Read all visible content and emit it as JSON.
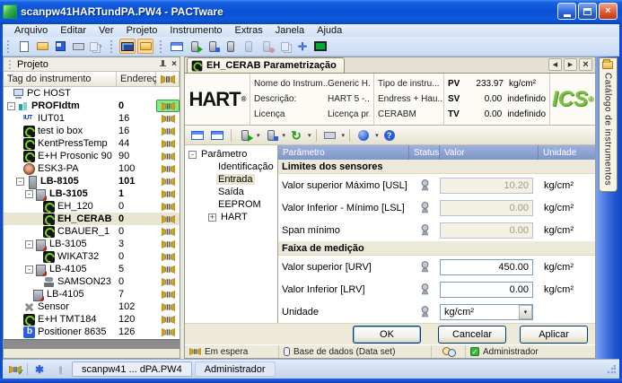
{
  "glyphs": {
    "dropdown": "▾",
    "nav_prev": "◀",
    "nav_next": "▶",
    "close": "×",
    "refresh": "↻",
    "help": "?",
    "asterisk": "✱",
    "pause": "||",
    "check": "✓",
    "reg": "®",
    "move": "✛"
  },
  "window": {
    "title": "scanpw41HARTundPA.PW4 - PACTware"
  },
  "menu": [
    "Arquivo",
    "Editar",
    "Ver",
    "Projeto",
    "Instrumento",
    "Extras",
    "Janela",
    "Ajuda"
  ],
  "project_panel": {
    "title": "Projeto",
    "columns": {
      "tag": "Tag do instrumento",
      "address": "Endereço"
    },
    "rows": [
      {
        "tag": "PC HOST",
        "addr": "",
        "icon": "pc",
        "level": 0,
        "noplug": true
      },
      {
        "tag": "PROFIdtm",
        "addr": "0",
        "icon": "profi",
        "level": 1,
        "bold": true,
        "expand": "-",
        "plugsel": true
      },
      {
        "tag": "IUT01",
        "addr": "16",
        "icon": "iut",
        "level": 2
      },
      {
        "tag": "test io box",
        "addr": "16",
        "icon": "ics",
        "level": 2
      },
      {
        "tag": "KentPressTemp",
        "addr": "44",
        "icon": "ics",
        "level": 2
      },
      {
        "tag": "E+H Prosonic 90",
        "addr": "90",
        "icon": "ics",
        "level": 2
      },
      {
        "tag": "ESK3-PA",
        "addr": "100",
        "icon": "esk",
        "level": 2
      },
      {
        "tag": "LB-8105",
        "addr": "101",
        "icon": "lb8",
        "level": 2,
        "bold": true,
        "expand": "-"
      },
      {
        "tag": "LB-3105",
        "addr": "1",
        "icon": "lb3",
        "level": 3,
        "bold": true,
        "expand": "-"
      },
      {
        "tag": "EH_120",
        "addr": "0",
        "icon": "ics",
        "level": 4
      },
      {
        "tag": "EH_CERAB",
        "addr": "0",
        "icon": "ics",
        "level": 4,
        "bold": true,
        "selected": true
      },
      {
        "tag": "CBAUER_1",
        "addr": "0",
        "icon": "ics",
        "level": 4
      },
      {
        "tag": "LB-3105",
        "addr": "3",
        "icon": "lb3",
        "level": 3,
        "expand": "-"
      },
      {
        "tag": "WIKAT32",
        "addr": "0",
        "icon": "ics",
        "level": 4
      },
      {
        "tag": "LB-4105",
        "addr": "5",
        "icon": "lb3",
        "level": 3,
        "expand": "-"
      },
      {
        "tag": "SAMSON23",
        "addr": "0",
        "icon": "samson",
        "level": 4
      },
      {
        "tag": "LB-4105",
        "addr": "7",
        "icon": "lb3",
        "level": 3
      },
      {
        "tag": "Sensor",
        "addr": "102",
        "icon": "sensor",
        "level": 2
      },
      {
        "tag": "E+H TMT184",
        "addr": "120",
        "icon": "ics",
        "level": 2
      },
      {
        "tag": "Positioner 8635",
        "addr": "126",
        "icon": "pos",
        "level": 2
      }
    ]
  },
  "doc": {
    "tab": "EH_CERAB Parametrização",
    "header": {
      "hart_logo": "HART",
      "ics_logo": "ICS",
      "fields": [
        {
          "label": "Nome do Instrum...",
          "value": "Generic H..."
        },
        {
          "label": "Descrição:",
          "value": "HART 5 -..."
        },
        {
          "label": "Licença",
          "value": "Licença pr..."
        }
      ],
      "col2": [
        "Tipo de instru...",
        "Endress + Hau...",
        "CERABM"
      ],
      "pv": [
        {
          "name": "PV",
          "value": "233.97",
          "unit": "kg/cm²"
        },
        {
          "name": "SV",
          "value": "0.00",
          "unit": "indefinido"
        },
        {
          "name": "TV",
          "value": "0.00",
          "unit": "indefinido"
        }
      ]
    },
    "tree": {
      "root": "Parâmetro",
      "root_expand": "-",
      "items": [
        {
          "label": "Identificação"
        },
        {
          "label": "Entrada",
          "selected": true
        },
        {
          "label": "Saída"
        },
        {
          "label": "EEPROM"
        },
        {
          "label": "HART",
          "expand": "+"
        }
      ]
    },
    "table": {
      "headers": {
        "param": "Parâmetro",
        "status": "Status",
        "value": "Valor",
        "unit": "Unidade"
      },
      "sections": [
        {
          "title": "Limites dos sensores",
          "rows": [
            {
              "label": "Valor superior Máximo [USL]",
              "value": "10.20",
              "unit": "kg/cm²",
              "disabled": true
            },
            {
              "label": "Valor Inferior - Mínimo [LSL]",
              "value": "0.00",
              "unit": "kg/cm²",
              "disabled": true
            },
            {
              "label": "Span mínimo",
              "value": "0.00",
              "unit": "kg/cm²",
              "disabled": true
            }
          ]
        },
        {
          "title": "Faixa de medição",
          "rows": [
            {
              "label": "Valor superior [URV]",
              "value": "450.00",
              "unit": "kg/cm²"
            },
            {
              "label": "Valor Inferior [LRV]",
              "value": "0.00",
              "unit": "kg/cm²"
            },
            {
              "label": "Unidade",
              "value": "kg/cm²",
              "unit": "",
              "dropdown": true
            }
          ]
        }
      ]
    },
    "buttons": {
      "ok": "OK",
      "cancel": "Cancelar",
      "apply": "Aplicar"
    },
    "statusbar": {
      "state": "Em espera",
      "database": "Base de dados (Data set)",
      "user": "Administrador"
    }
  },
  "taskbar": {
    "project_tab": "scanpw41 ... dPA.PW4",
    "user_tab": "Administrador"
  },
  "catalog_tab": "Catálogo de instrumentos",
  "colors": {
    "titlebar_blue": "#0b51d3",
    "table_header_blue": "#8ca6d8",
    "plug_gold": "#c9a227",
    "selection_green": "#86e886",
    "ics_green": "#7ac143"
  }
}
